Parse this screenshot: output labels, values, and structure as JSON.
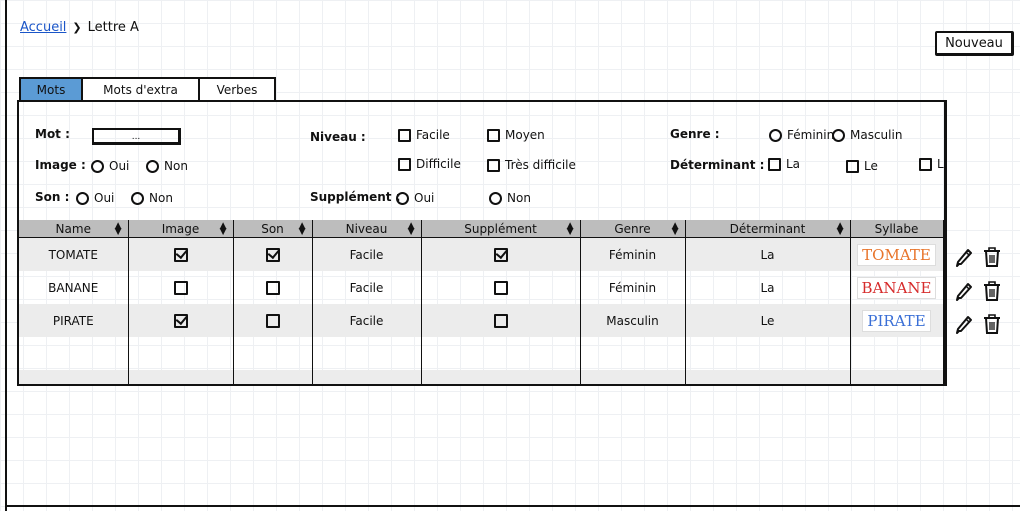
{
  "breadcrumb": {
    "home": "Accueil",
    "sep": "❯",
    "current": "Lettre A"
  },
  "toolbar": {
    "new_label": "Nouveau"
  },
  "tabs": [
    {
      "label": "Mots",
      "active": true
    },
    {
      "label": "Mots d'extra",
      "active": false
    },
    {
      "label": "Verbes",
      "active": false
    }
  ],
  "form": {
    "mot_label": "Mot :",
    "mot_value": "...",
    "image_label": "Image :",
    "image_options": [
      "Oui",
      "Non"
    ],
    "son_label": "Son :",
    "son_options": [
      "Oui",
      "Non"
    ],
    "niveau_label": "Niveau :",
    "niveau_options": [
      "Facile",
      "Moyen",
      "Difficile",
      "Très difficile"
    ],
    "supplement_label": "Supplément :",
    "supplement_options": [
      "Oui",
      "Non"
    ],
    "genre_label": "Genre :",
    "genre_options": [
      "Féminin",
      "Masculin"
    ],
    "determinant_label": "Déterminant :",
    "determinant_options": [
      "La",
      "Le",
      "L'"
    ]
  },
  "table": {
    "headers": [
      "Name",
      "Image",
      "Son",
      "Niveau",
      "Supplément",
      "Genre",
      "Déterminant",
      "Syllabe"
    ],
    "rows": [
      {
        "name": "TOMATE",
        "image": true,
        "son": true,
        "niveau": "Facile",
        "supplement": true,
        "genre": "Féminin",
        "determinant": "La",
        "syllabe": "TOMATE",
        "syllabe_color": "#e8742a"
      },
      {
        "name": "BANANE",
        "image": false,
        "son": false,
        "niveau": "Facile",
        "supplement": false,
        "genre": "Féminin",
        "determinant": "La",
        "syllabe": "BANANE",
        "syllabe_color": "#d62b2b"
      },
      {
        "name": "PIRATE",
        "image": true,
        "son": false,
        "niveau": "Facile",
        "supplement": false,
        "genre": "Masculin",
        "determinant": "Le",
        "syllabe": "PIRATE",
        "syllabe_color": "#3a6fd6"
      }
    ]
  },
  "icons": {
    "edit": "pencil-icon",
    "delete": "trash-icon"
  }
}
